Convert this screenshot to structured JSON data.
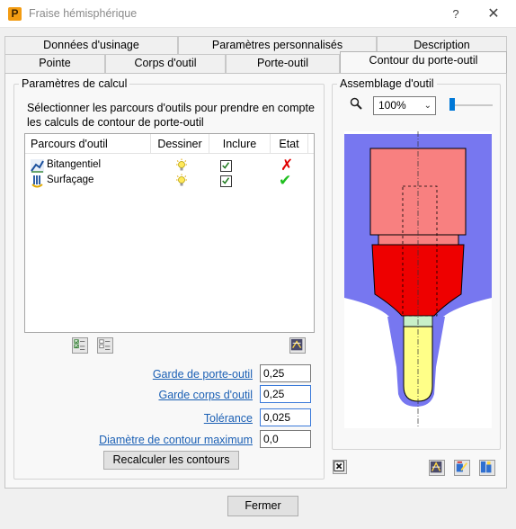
{
  "window": {
    "title": "Fraise hémisphérique",
    "app_icon_letter": "P",
    "help_glyph": "?",
    "close_glyph": "✕"
  },
  "tabs_row1": [
    {
      "label": "Données d'usinage"
    },
    {
      "label": "Paramètres personnalisés"
    },
    {
      "label": "Description"
    }
  ],
  "tabs_row2": [
    {
      "label": "Pointe"
    },
    {
      "label": "Corps d'outil"
    },
    {
      "label": "Porte-outil"
    },
    {
      "label": "Contour du porte-outil",
      "active": true
    }
  ],
  "calc": {
    "group_title": "Paramètres de calcul",
    "instruction": "Sélectionner les parcours d'outils pour prendre en compte les calculs de contour de porte-outil",
    "columns": [
      "Parcours d'outil",
      "Dessiner",
      "Inclure",
      "Etat"
    ],
    "rows": [
      {
        "name": "Bitangentiel",
        "draw_icon": "bulb-icon",
        "include": true,
        "status": "✗",
        "status_color": "#e00000"
      },
      {
        "name": "Surfaçage",
        "draw_icon": "bulb-icon",
        "include": true,
        "status": "✔",
        "status_color": "#1fbf1f"
      }
    ]
  },
  "fields": [
    {
      "label": "Garde de porte-outil",
      "value": "0,25"
    },
    {
      "label": "Garde corps d'outil",
      "value": "0,25"
    },
    {
      "label": "Tolérance",
      "value": "0,025"
    },
    {
      "label": "Diamètre de contour maximum",
      "value": "0,0"
    }
  ],
  "recalc_label": "Recalculer les contours",
  "assembly": {
    "group_title": "Assemblage d'outil",
    "zoom": "100%",
    "zoom_slider_fraction": 0.0
  },
  "close_button": "Fermer",
  "colors": {
    "holder_upper": "#f88080",
    "holder_lower": "#ee0000",
    "shank": "#ffff88",
    "neck": "#c8f0c8",
    "contour": "#7777f0",
    "accent": "#1a5fb4"
  }
}
